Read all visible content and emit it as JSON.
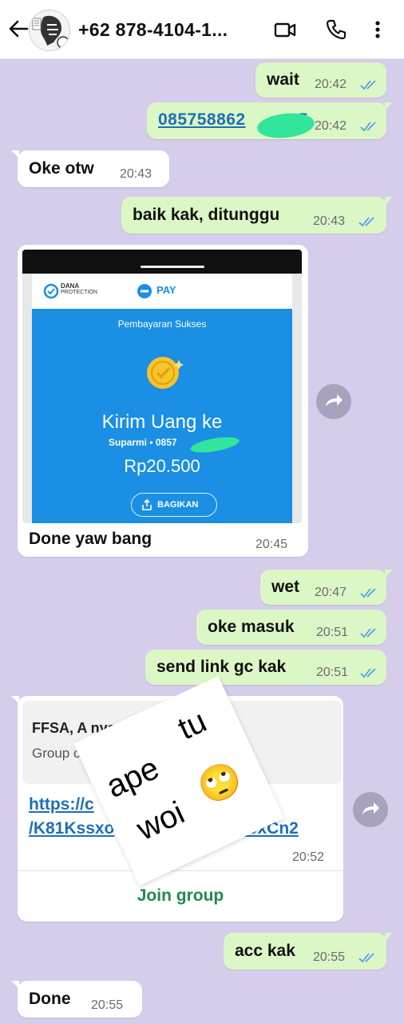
{
  "header": {
    "title": "+62 878-4104-1...",
    "avatar_icon": "avatar-image"
  },
  "messages": [
    {
      "id": "m1",
      "dir": "out",
      "text": "wait",
      "time": "20:42",
      "status": "read"
    },
    {
      "id": "m2",
      "dir": "out",
      "text": "085758862",
      "text_tail": "5",
      "time": "20:42",
      "status": "read",
      "is_link": true
    },
    {
      "id": "m3",
      "dir": "in",
      "text": "Oke otw",
      "time": "20:43"
    },
    {
      "id": "m4",
      "dir": "out",
      "text": "baik kak, ditunggu",
      "time": "20:43",
      "status": "read"
    },
    {
      "id": "m5",
      "dir": "in",
      "type": "image",
      "caption": "Done yaw bang",
      "time": "20:45",
      "image": {
        "brand": "DANA",
        "brand_sub": "PROTECTION",
        "pay_label": "PAY",
        "status": "Pembayaran Sukses",
        "headline": "Kirim Uang ke",
        "recipient": "Suparmi • 0857",
        "amount": "Rp20.500",
        "share_button": "BAGIKAN"
      }
    },
    {
      "id": "m6",
      "dir": "out",
      "text": "wet",
      "time": "20:47",
      "status": "read"
    },
    {
      "id": "m7",
      "dir": "out",
      "text": "oke masuk",
      "time": "20:51",
      "status": "read"
    },
    {
      "id": "m8",
      "dir": "out",
      "text": "send link gc kak",
      "time": "20:51",
      "status": "read"
    },
    {
      "id": "m9",
      "dir": "in",
      "type": "group_link",
      "time": "20:52",
      "preview_title": "FFSA, A nya Anc",
      "preview_sub": "Group chat in",
      "link_line1_start": "https://c",
      "link_line1_end": "om",
      "link_line2_start": "/K81Kssxo",
      "link_line2_end": "7oxCn2",
      "join_label": "Join group"
    },
    {
      "id": "m10",
      "dir": "out",
      "text": "acc kak",
      "time": "20:55",
      "status": "read"
    },
    {
      "id": "m11",
      "dir": "in",
      "text": "Done",
      "time": "20:55"
    }
  ],
  "sticker": {
    "line1": "ape",
    "line1b": "tu",
    "line2": "woi",
    "emoji": "🙄"
  },
  "colors": {
    "chat_bg": "#d5cdea",
    "outgoing_bubble": "#dcf7c6",
    "incoming_bubble": "#ffffff",
    "read_ticks": "#4fa3e0",
    "link": "#1d6fb8",
    "join_group": "#1f8a4c",
    "dana_blue": "#1a8fe3"
  }
}
